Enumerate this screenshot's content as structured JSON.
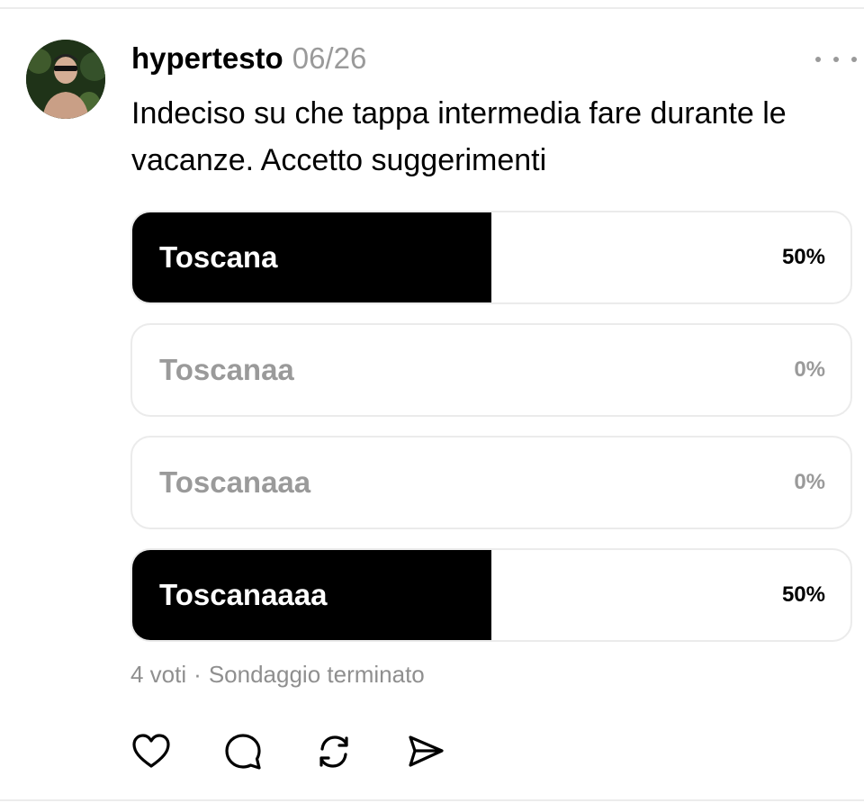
{
  "post": {
    "username": "hypertesto",
    "timestamp": "06/26",
    "text": "Indeciso su che tappa intermedia fare durante le vacanze. Accetto suggerimenti"
  },
  "poll": {
    "options": [
      {
        "label": "Toscana",
        "percent_label": "50%",
        "share": 0.5
      },
      {
        "label": "Toscanaa",
        "percent_label": "0%",
        "share": 0
      },
      {
        "label": "Toscanaaa",
        "percent_label": "0%",
        "share": 0
      },
      {
        "label": "Toscanaaaa",
        "percent_label": "50%",
        "share": 0.5
      }
    ],
    "votes": "4 voti",
    "separator": "·",
    "status": "Sondaggio terminato"
  },
  "actions": [
    {
      "icon": "heart-icon"
    },
    {
      "icon": "comment-icon"
    },
    {
      "icon": "repost-icon"
    },
    {
      "icon": "share-icon"
    }
  ]
}
